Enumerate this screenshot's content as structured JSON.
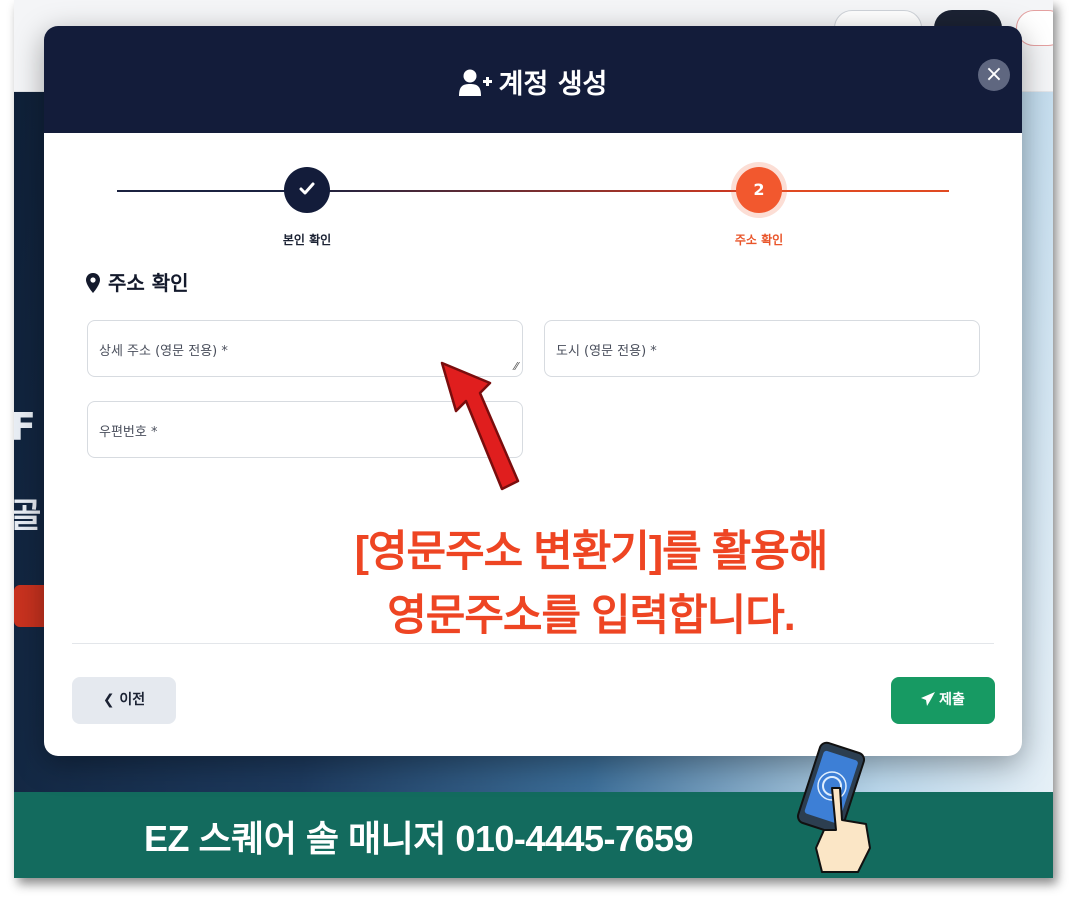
{
  "modal": {
    "title": "계정 생성",
    "close_glyph": "×",
    "steps": [
      {
        "number": "1",
        "label": "본인 확인",
        "state": "completed"
      },
      {
        "number": "2",
        "label": "주소 확인",
        "state": "active"
      }
    ],
    "section_title": "주소 확인",
    "fields": {
      "detail_address": {
        "placeholder": "상세 주소 (영문 전용) *",
        "value": ""
      },
      "city": {
        "placeholder": "도시 (영문 전용) *",
        "value": ""
      },
      "postal_code": {
        "placeholder": "우편번호 *",
        "value": ""
      }
    },
    "prev_label": "이전",
    "submit_label": "제출"
  },
  "annotation": {
    "line1": "[영문주소 변환기]를 활용해",
    "line2": "영문주소를 입력합니다."
  },
  "banner": {
    "text": "EZ 스퀘어 솔 매니저  010-4445-7659"
  },
  "colors": {
    "header_bg": "#131c3a",
    "active_step": "#f2582e",
    "submit_bg": "#179a63",
    "annotation": "#ee4523",
    "banner_bg": "#136b5e"
  },
  "icons": {
    "title": "user-plus-icon",
    "section": "map-marker-icon",
    "completed_step": "check-icon",
    "prev": "chevron-left-icon",
    "submit": "paper-plane-icon"
  }
}
